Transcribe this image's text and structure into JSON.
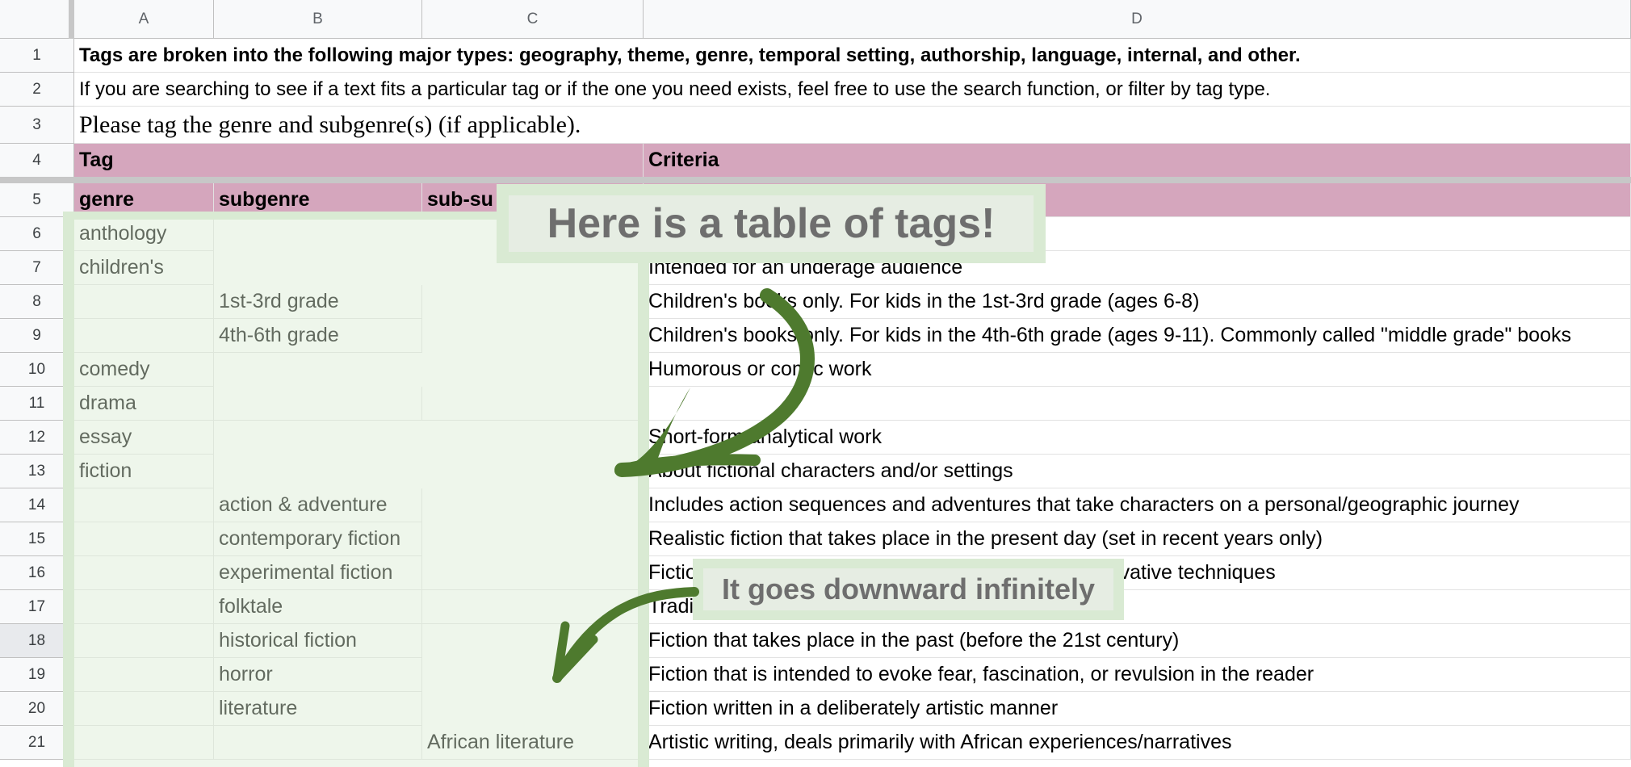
{
  "columns": [
    "A",
    "B",
    "C",
    "D"
  ],
  "row_numbers": [
    "1",
    "2",
    "3",
    "4",
    "5",
    "6",
    "7",
    "8",
    "9",
    "10",
    "11",
    "12",
    "13",
    "14",
    "15",
    "16",
    "17",
    "18",
    "19",
    "20",
    "21"
  ],
  "rows": {
    "r1": "Tags are broken into the following major types: geography, theme, genre, temporal setting, authorship, language, internal, and other.",
    "r2": "If you are searching to see if a text fits a particular tag or if the one you need exists, feel free to use the search function, or filter by tag type.",
    "r3": "Please tag the genre and subgenre(s) (if applicable).",
    "r4": {
      "tag": "Tag",
      "criteria": "Criteria"
    },
    "r5": {
      "genre": "genre",
      "subgenre": "subgenre",
      "subsub": "sub-su"
    },
    "r6": {
      "a": "anthology",
      "d": ""
    },
    "r7": {
      "a": "children's",
      "d": "Intended for an underage audience"
    },
    "r8": {
      "b": "1st-3rd grade",
      "d": "Children's books only. For kids in the 1st-3rd grade (ages 6-8)"
    },
    "r9": {
      "b": "4th-6th grade",
      "d": "Children's books only. For kids in the 4th-6th grade (ages 9-11). Commonly called \"middle grade\" books"
    },
    "r10": {
      "a": "comedy",
      "d": "Humorous or comic work"
    },
    "r11": {
      "a": "drama",
      "d": ""
    },
    "r12": {
      "a": "essay",
      "d": "Short-form analytical work"
    },
    "r13": {
      "a": "fiction",
      "d": "About fictional characters and/or settings"
    },
    "r14": {
      "b": "action & adventure",
      "d": "Includes action sequences and adventures that take characters on a personal/geographic journey"
    },
    "r15": {
      "b": "contemporary fiction",
      "d": "Realistic fiction that takes place in the present day (set in recent years only)"
    },
    "r16": {
      "b": "experimental fiction",
      "d": "Fiction that breaks from traditional writing, using innovative techniques"
    },
    "r17": {
      "b": "folktale",
      "d": "Traditional stories passed down orally"
    },
    "r18": {
      "b": "historical fiction",
      "d": "Fiction that takes place in the past (before the 21st century)"
    },
    "r19": {
      "b": "horror",
      "d": "Fiction that is intended to evoke fear, fascination, or revulsion in the reader"
    },
    "r20": {
      "b": "literature",
      "d": "Fiction written in a deliberately artistic manner"
    },
    "r21": {
      "c": "African literature",
      "d": "Artistic writing, deals primarily with African experiences/narratives"
    }
  },
  "callouts": {
    "main": "Here is a table of tags!",
    "secondary": "It goes downward infinitely"
  },
  "colors": {
    "header_pink": "#d5a6bd",
    "callout_green": "#d9ead3",
    "arrow_green": "#4e7a2e"
  }
}
